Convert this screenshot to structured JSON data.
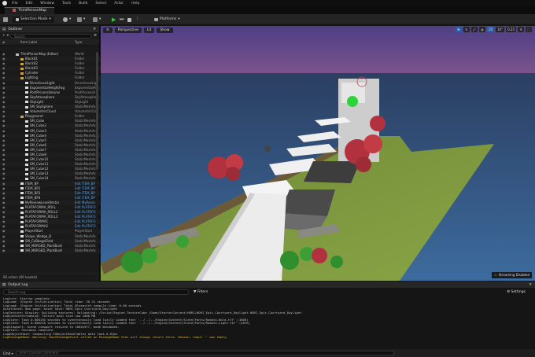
{
  "menu": [
    "File",
    "Edit",
    "Window",
    "Tools",
    "Build",
    "Select",
    "Actor",
    "Help"
  ],
  "tab": {
    "title": "ThirdPersonMap"
  },
  "toolbar": {
    "mode": "Selection Mode",
    "platforms": "Platforms"
  },
  "outliner": {
    "title": "Outliner",
    "search_placeholder": "Search",
    "col_label": "Item Label",
    "col_type": "Type",
    "footer": "66 actors (66 loaded)",
    "rows": [
      {
        "name": "ThirdPersonMap (Editor)",
        "type": "World",
        "indent": 0,
        "icon": "#bbb"
      },
      {
        "name": "Block01",
        "type": "Folder",
        "indent": 1,
        "icon": "#c9a44a"
      },
      {
        "name": "Block02",
        "type": "Folder",
        "indent": 1,
        "icon": "#c9a44a"
      },
      {
        "name": "Block03",
        "type": "Folder",
        "indent": 1,
        "icon": "#c9a44a"
      },
      {
        "name": "Cylinder",
        "type": "Folder",
        "indent": 1,
        "icon": "#c9a44a"
      },
      {
        "name": "Lighting",
        "type": "Folder",
        "indent": 1,
        "icon": "#c9a44a"
      },
      {
        "name": "DirectionalLight",
        "type": "DirectionalLig",
        "indent": 2,
        "icon": "#ddd"
      },
      {
        "name": "ExponentialHeightFog",
        "type": "ExponentialHe",
        "indent": 2,
        "icon": "#ddd"
      },
      {
        "name": "PostProcessVolume",
        "type": "PostProcessV",
        "indent": 2,
        "icon": "#ddd"
      },
      {
        "name": "SkyAtmosphere",
        "type": "SkyAtmosphe",
        "indent": 2,
        "icon": "#ddd"
      },
      {
        "name": "SkyLight",
        "type": "SkyLight",
        "indent": 2,
        "icon": "#ddd"
      },
      {
        "name": "SM_SkySphere",
        "type": "StaticMeshAc",
        "indent": 2,
        "icon": "#ddd"
      },
      {
        "name": "VolumetricCloud",
        "type": "VolumetricClo",
        "indent": 2,
        "icon": "#ddd"
      },
      {
        "name": "Playground",
        "type": "Folder",
        "indent": 1,
        "icon": "#c9a44a"
      },
      {
        "name": "SM_Cube",
        "type": "StaticMeshAc",
        "indent": 2,
        "icon": "#ddd"
      },
      {
        "name": "SM_Cube2",
        "type": "StaticMeshAc",
        "indent": 2,
        "icon": "#ddd"
      },
      {
        "name": "SM_Cube3",
        "type": "StaticMeshAc",
        "indent": 2,
        "icon": "#ddd"
      },
      {
        "name": "SM_Cube4",
        "type": "StaticMeshAc",
        "indent": 2,
        "icon": "#ddd"
      },
      {
        "name": "SM_Cube5",
        "type": "StaticMeshAc",
        "indent": 2,
        "icon": "#ddd"
      },
      {
        "name": "SM_Cube6",
        "type": "StaticMeshAc",
        "indent": 2,
        "icon": "#ddd"
      },
      {
        "name": "SM_Cube7",
        "type": "StaticMeshAc",
        "indent": 2,
        "icon": "#ddd"
      },
      {
        "name": "SM_Cube8",
        "type": "StaticMeshAc",
        "indent": 2,
        "icon": "#ddd"
      },
      {
        "name": "SM_Cube10",
        "type": "StaticMeshAc",
        "indent": 2,
        "icon": "#ddd"
      },
      {
        "name": "SM_Cube11",
        "type": "StaticMeshAc",
        "indent": 2,
        "icon": "#ddd"
      },
      {
        "name": "SM_Cube12",
        "type": "StaticMeshAc",
        "indent": 2,
        "icon": "#ddd"
      },
      {
        "name": "SM_Cube13",
        "type": "StaticMeshAc",
        "indent": 2,
        "icon": "#ddd"
      },
      {
        "name": "SM_Cube14",
        "type": "StaticMeshAc",
        "indent": 2,
        "icon": "#ddd"
      },
      {
        "name": "ITEM_BP",
        "type": "Edit ITEM_BP",
        "indent": 1,
        "icon": "#ddd",
        "link": true
      },
      {
        "name": "ITEM_BP2",
        "type": "Edit ITEM_BP",
        "indent": 1,
        "icon": "#ddd",
        "link": true
      },
      {
        "name": "ITEM_BP3",
        "type": "Edit ITEM_BP",
        "indent": 1,
        "icon": "#ddd",
        "link": true
      },
      {
        "name": "ITEM_BP4",
        "type": "Edit ITEM_BP",
        "indent": 1,
        "icon": "#ddd",
        "link": true
      },
      {
        "name": "MyReviewLevelVector",
        "type": "Edit MyRevie",
        "indent": 1,
        "icon": "#ddd",
        "link": true
      },
      {
        "name": "PLATAFORMA_ROLL",
        "type": "Edit PLATAFO",
        "indent": 1,
        "icon": "#ddd",
        "link": true
      },
      {
        "name": "PLATAFORMA_ROLL2",
        "type": "Edit PLATAFO",
        "indent": 1,
        "icon": "#ddd",
        "link": true
      },
      {
        "name": "PLATAFORMA_ROLL3",
        "type": "Edit PLATAFO",
        "indent": 1,
        "icon": "#ddd",
        "link": true
      },
      {
        "name": "PLATAFORMA1",
        "type": "Edit PLATAFO",
        "indent": 1,
        "icon": "#ddd",
        "link": true
      },
      {
        "name": "PLATAFORMA2",
        "type": "Edit PLATAFO",
        "indent": 1,
        "icon": "#ddd",
        "link": true
      },
      {
        "name": "PlayerStart",
        "type": "PlayerStart",
        "indent": 1,
        "icon": "#ddd"
      },
      {
        "name": "Shape_Wedge_B",
        "type": "StaticMeshAc",
        "indent": 1,
        "icon": "#ddd"
      },
      {
        "name": "SM_CoBbageField",
        "type": "StaticMeshAc",
        "indent": 1,
        "icon": "#ddd"
      },
      {
        "name": "SM_MERGED_PlantBush",
        "type": "StaticMeshAc",
        "indent": 1,
        "icon": "#ddd"
      },
      {
        "name": "SM_MERGED_PlantBush",
        "type": "StaticMeshAc",
        "indent": 1,
        "icon": "#ddd"
      }
    ]
  },
  "viewport": {
    "perspective": "Perspective",
    "lit": "Lit",
    "show": "Show",
    "right_controls": [
      "10",
      "10°",
      "0.25",
      "4"
    ],
    "streaming_status": "Streaming Disabled"
  },
  "output_log": {
    "title": "Output Log",
    "search_placeholder": "Search Log",
    "filters": "Filters",
    "settings": "Settings",
    "lines": [
      {
        "text": "LogInit: Startup complete.",
        "warn": false
      },
      {
        "text": "LogLoad: (Engine Initialization) Total time: 38.31 seconds",
        "warn": false
      },
      {
        "text": "LogLoad: (Engine Initialization) Total Blueprint compile time: 0.00 seconds",
        "warn": false
      },
      {
        "text": "AssetCheck: New page: Asset Save: HDRI_Epic_Courtyard_Daylight",
        "warn": false
      },
      {
        "text": "LogTexture: Display: Building textures: Validating: /Script/Engine.TextureCube /Game/StarterContent/HDRI/HDRI_Epic_Courtyard_Daylight.HDRI_Epic_Courtyard_Daylight",
        "warn": false
      },
      {
        "text": "LogContentStreaming: Texture pool size now 1000 MB",
        "warn": false
      },
      {
        "text": "LogSlate: Took 0.000150 seconds to synchronously load lazily loaded font '../../../Engine/Content/Slate/Fonts/Roboto-Bold.ttf' (160K)",
        "warn": false
      },
      {
        "text": "LogSlate: Took 0.000228 seconds to synchronously load lazily loaded font '../../../Engine/Content/Slate/Fonts/Roboto-Light.ttf' (167K)",
        "warn": false
      },
      {
        "text": "LogViewport: Scene viewport resized to 1094x977, mode Windowed.",
        "warn": false
      },
      {
        "text": "LogStall: Shutdown complete.",
        "warn": false
      },
      {
        "text": "LogUObjectHash: Compacting FUObjectHashTables data took 0.61ms",
        "warn": false
      },
      {
        "text": "LogPackageName: Warning: DoesPackageExist called on PackageName that will always return false. Reason: Input '' was empty.",
        "warn": true
      }
    ]
  },
  "cmd": {
    "label": "Cmd",
    "placeholder": "Enter Console Command"
  },
  "colors": {
    "accent": "#3a5ea8",
    "play_green": "#3cc44a",
    "warning": "#e0b030",
    "link_blue": "#5aa0e6"
  }
}
